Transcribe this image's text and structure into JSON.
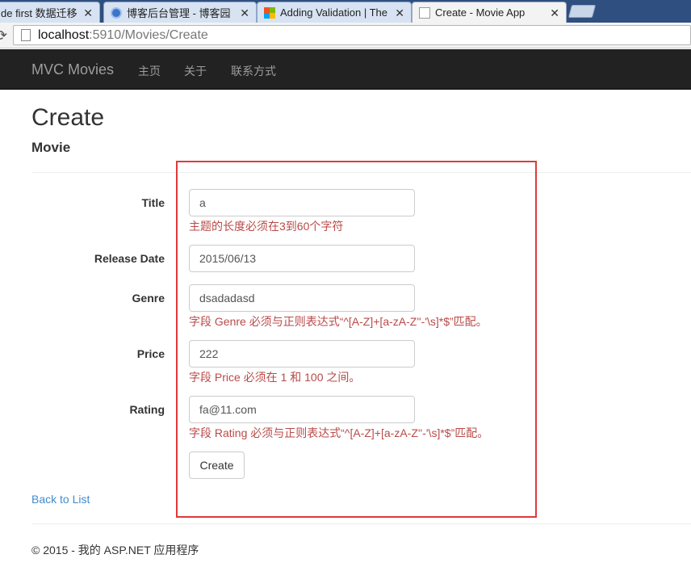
{
  "browser": {
    "tabs": [
      {
        "label": "de first 数据迁移",
        "icon": "none"
      },
      {
        "label": "博客后台管理 - 博客园",
        "icon": "blog-icon"
      },
      {
        "label": "Adding Validation | The",
        "icon": "windows-icon"
      },
      {
        "label": "Create - Movie App",
        "icon": "page-icon"
      }
    ],
    "url_host": "localhost",
    "url_path": ":5910/Movies/Create"
  },
  "navbar": {
    "brand": "MVC Movies",
    "links": [
      "主页",
      "关于",
      "联系方式"
    ],
    "bg": "#222222"
  },
  "page": {
    "title": "Create",
    "subtitle": "Movie"
  },
  "form": {
    "fields": [
      {
        "label": "Title",
        "value": "a",
        "error": "主题的长度必须在3到60个字符"
      },
      {
        "label": "Release Date",
        "value": "2015/06/13",
        "error": ""
      },
      {
        "label": "Genre",
        "value": "dsadadasd",
        "error": "字段 Genre 必须与正则表达式“^[A-Z]+[a-zA-Z''-'\\s]*$”匹配。"
      },
      {
        "label": "Price",
        "value": "222",
        "error": "字段 Price 必须在 1 和 100 之间。"
      },
      {
        "label": "Rating",
        "value": "fa@11.com",
        "error": "字段 Rating 必须与正则表达式“^[A-Z]+[a-zA-Z''-'\\s]*$”匹配。"
      }
    ],
    "submit_label": "Create",
    "error_color": "#b94a48",
    "highlight_color": "#e03a3a"
  },
  "back_link": "Back to List",
  "footer": "© 2015 - 我的 ASP.NET 应用程序"
}
